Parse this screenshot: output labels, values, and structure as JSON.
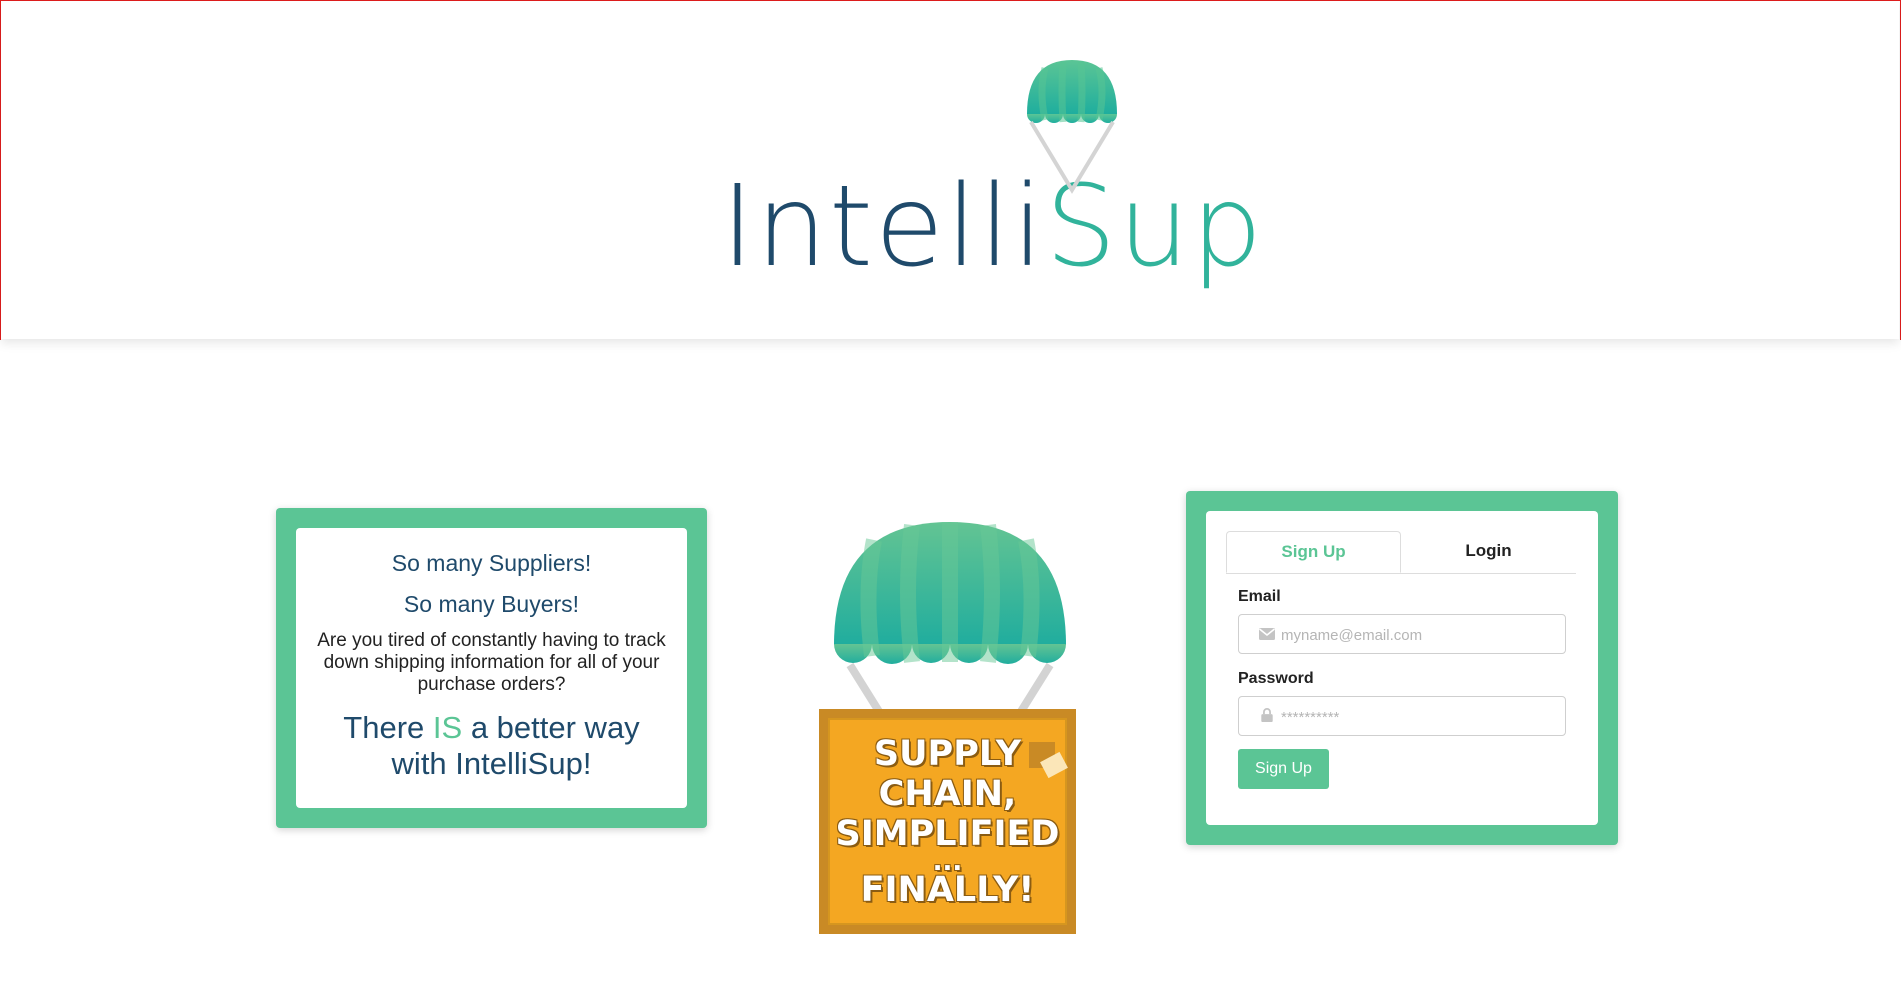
{
  "brand": {
    "name_part1": "Intelli",
    "name_part2": "Sup",
    "logo_icon": "parachute-icon",
    "colors": {
      "navy": "#1f4a6b",
      "teal": "#31b39b",
      "green": "#5bc595",
      "crate": "#f4a722"
    }
  },
  "pitch": {
    "line1": "So many Suppliers!",
    "line2": "So many Buyers!",
    "line3": "Are you tired of constantly having to track down shipping information for all of your purchase orders?",
    "line4_before": "There ",
    "line4_accent": "IS",
    "line4_after": " a better way with IntelliSup!"
  },
  "crate": {
    "line1": "SUPPLY",
    "line2": "CHAIN,",
    "line3": "SIMPLIFIED",
    "line4": "...",
    "line5": "FINALLY!"
  },
  "auth": {
    "tabs": [
      {
        "label": "Sign Up",
        "active": true
      },
      {
        "label": "Login",
        "active": false
      }
    ],
    "email_label": "Email",
    "email_placeholder": "myname@email.com",
    "email_icon": "envelope-icon",
    "password_label": "Password",
    "password_placeholder": "**********",
    "password_icon": "lock-icon",
    "submit_label": "Sign Up"
  }
}
